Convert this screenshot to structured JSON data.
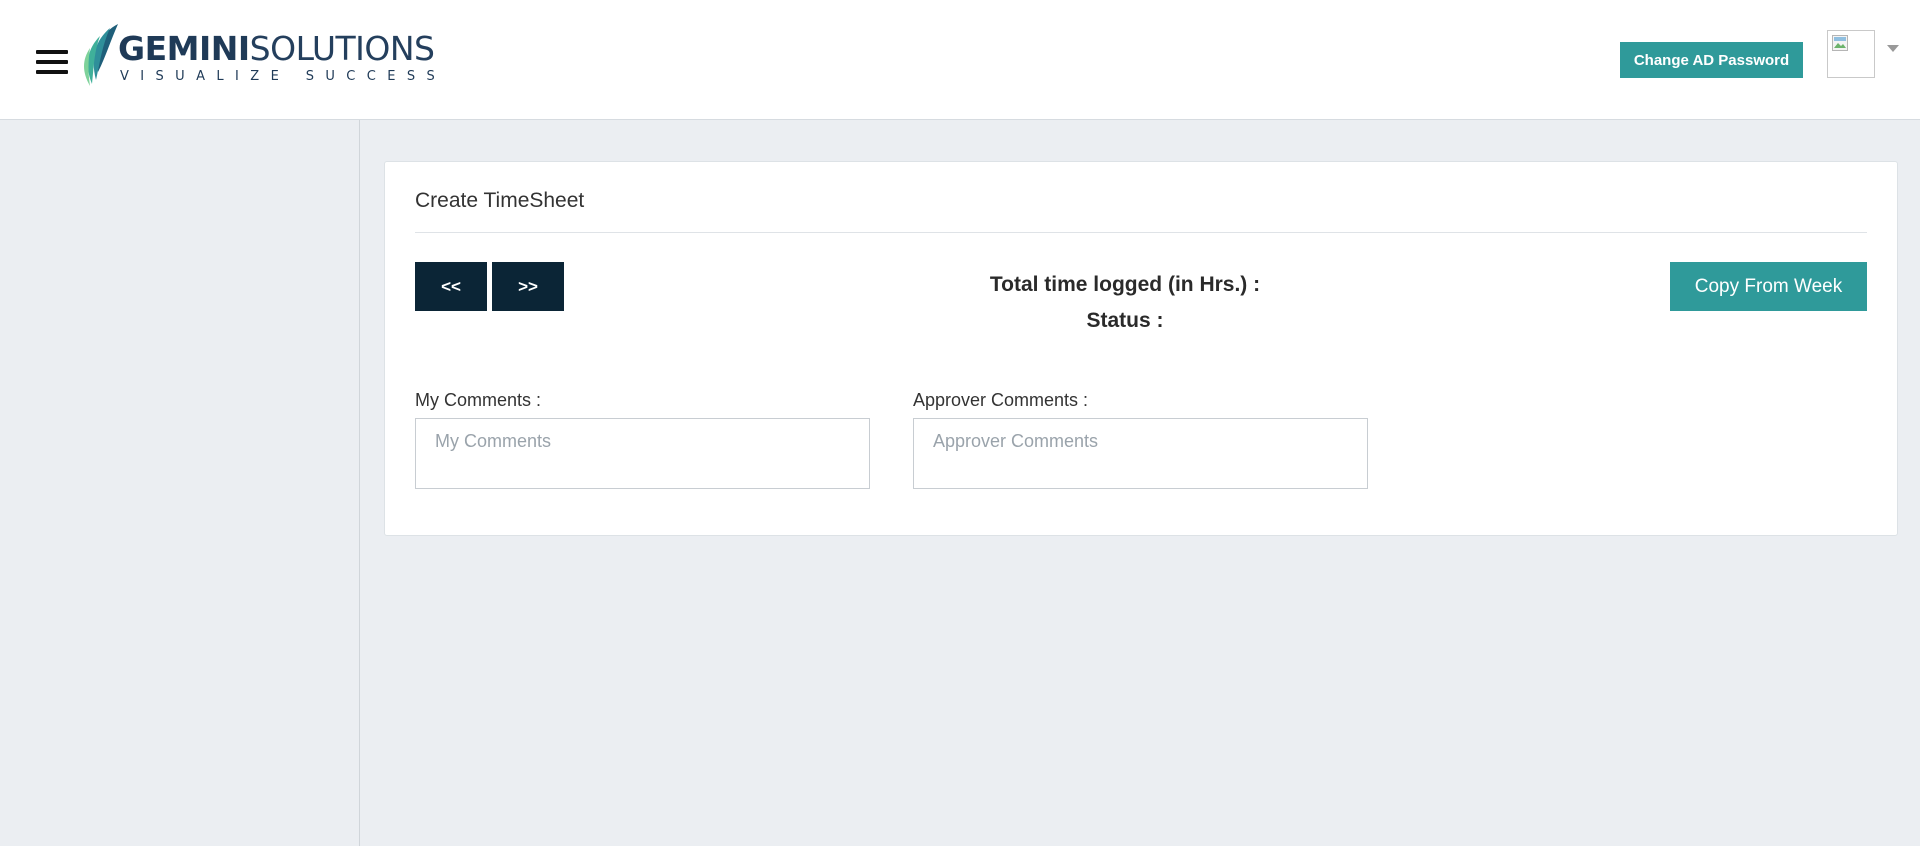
{
  "header": {
    "brand": {
      "name_bold": "GEMINI",
      "name_light": "SOLUTIONS",
      "tagline": "VISUALIZE SUCCESS"
    },
    "change_password_label": "Change AD Password",
    "menu_icon": "hamburger-icon",
    "avatar_icon": "broken-image-icon"
  },
  "card": {
    "title": "Create TimeSheet",
    "prev_label": "<<",
    "next_label": ">>",
    "total_time_label": "Total time logged (in Hrs.) :",
    "status_label": "Status :",
    "copy_label": "Copy From Week",
    "my_comments": {
      "label": "My Comments :",
      "placeholder": "My Comments",
      "value": ""
    },
    "approver_comments": {
      "label": "Approver Comments :",
      "placeholder": "Approver Comments",
      "value": ""
    }
  },
  "colors": {
    "accent_teal": "#2f9a9a",
    "nav_dark": "#0b2536",
    "page_bg": "#ebeef2",
    "brand_navy": "#1f3a57"
  }
}
